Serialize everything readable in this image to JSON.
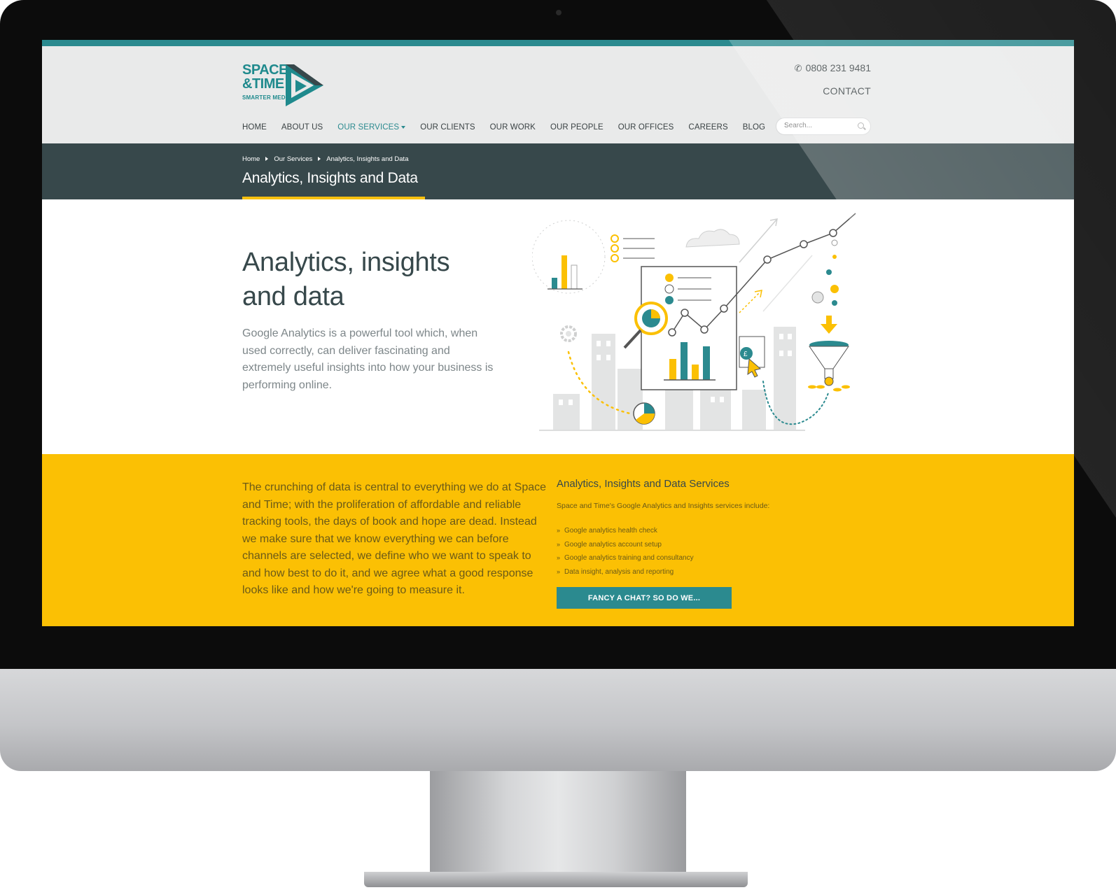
{
  "brand": {
    "logo_line1": "SPACE",
    "logo_line2": "&TIME",
    "logo_tagline": "SMARTER MEDIA",
    "primary_color": "#2b8a8f",
    "accent_color": "#fbc004",
    "dark_color": "#37484b"
  },
  "header": {
    "phone": "0808 231 9481",
    "phone_icon": "phone-icon",
    "contact_label": "CONTACT",
    "search_placeholder": "Search...",
    "search_icon": "search-icon"
  },
  "nav": {
    "items": [
      {
        "label": "HOME"
      },
      {
        "label": "ABOUT US"
      },
      {
        "label": "OUR SERVICES",
        "active": true
      },
      {
        "label": "OUR CLIENTS"
      },
      {
        "label": "OUR WORK"
      },
      {
        "label": "OUR PEOPLE"
      },
      {
        "label": "OUR OFFICES"
      },
      {
        "label": "CAREERS"
      },
      {
        "label": "BLOG"
      }
    ]
  },
  "breadcrumb": [
    "Home",
    "Our Services",
    "Analytics, Insights and Data"
  ],
  "page_title": "Analytics, Insights and Data",
  "hero": {
    "heading": "Analytics, insights and data",
    "paragraph": "Google Analytics is a powerful tool which, when used correctly, can deliver fascinating and extremely useful insights into how your business is performing online."
  },
  "services": {
    "paragraph": "The crunching of data is central to everything we do at Space and Time; with the proliferation of affordable and reliable tracking tools, the days of book and hope are dead. Instead we make sure that we know everything we can before channels are selected, we define who we want to speak to and how best to do it, and we agree what a good response looks like and how we're going to measure it.",
    "heading": "Analytics, Insights and Data Services",
    "intro": "Space and Time's Google Analytics and Insights services include:",
    "items": [
      "Google analytics health check",
      "Google analytics account setup",
      "Google analytics training and consultancy",
      "Data insight, analysis and reporting"
    ],
    "cta_label": "FANCY A CHAT? SO DO WE..."
  }
}
